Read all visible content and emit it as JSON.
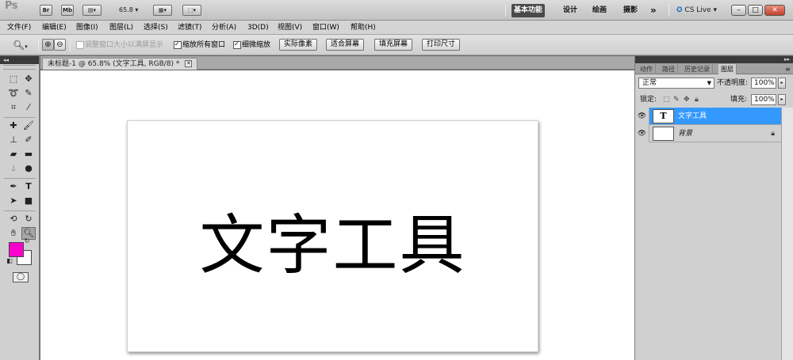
{
  "app": {
    "logo": "Ps",
    "br_label": "Br",
    "mb_label": "Mb",
    "zoom_value": "65.8",
    "workspaces": [
      "基本功能",
      "设计",
      "绘画",
      "摄影"
    ],
    "more_label": "»",
    "cs_live": "CS Live",
    "win_min": "–",
    "win_max": "□",
    "win_close": "✕"
  },
  "menu": [
    "文件(F)",
    "编辑(E)",
    "图像(I)",
    "图层(L)",
    "选择(S)",
    "滤镜(T)",
    "分析(A)",
    "3D(D)",
    "视图(V)",
    "窗口(W)",
    "帮助(H)"
  ],
  "options": {
    "resize_windows": "调整窗口大小以满屏显示",
    "zoom_all": "缩放所有窗口",
    "scrubby_zoom": "细微缩放",
    "actual_pixels": "实际像素",
    "fit_screen": "适合屏幕",
    "fill_screen": "填充屏幕",
    "print_size": "打印尺寸"
  },
  "document": {
    "tab_title": "未标题-1 @ 65.8% (文字工具, RGB/8) *",
    "close": "✕",
    "canvas_text": "文字工具"
  },
  "colors": {
    "foreground": "#ff00cc",
    "background": "#ffffff",
    "layer_selected": "#3399ff"
  },
  "panel": {
    "tabs": [
      "动作",
      "路径",
      "历史记录",
      "图层"
    ],
    "blend_mode": "正常",
    "opacity_label": "不透明度:",
    "opacity_value": "100%",
    "lock_label": "锁定:",
    "fill_label": "填充:",
    "fill_value": "100%",
    "layers": [
      {
        "name": "文字工具",
        "thumb": "T",
        "selected": true
      },
      {
        "name": "背景",
        "thumb": "",
        "selected": false,
        "locked": true
      }
    ]
  }
}
